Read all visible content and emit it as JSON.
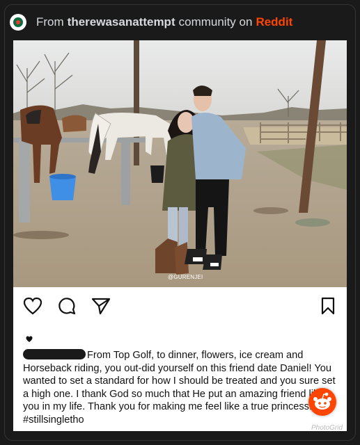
{
  "header": {
    "prefix": "From",
    "community": "therewasanattempt",
    "middle": "community on",
    "brand": "Reddit"
  },
  "post": {
    "photo_credit": "@GURENJEI",
    "caption": "From Top Golf, to dinner, flowers, ice cream and Horseback riding, you out-did yourself on this friend date Daniel! You wanted to set a standard for how I should be treated and you sure set a high one. I thank God so much that He put an amazing friend like you in my life. Thank you for making me feel like a true princess! #stillsingletho"
  },
  "watermark": "PhotoGrid",
  "colors": {
    "background": "#1a1a1b",
    "reddit_orange": "#ff4500",
    "community_icon": "#0e6b3e"
  },
  "icons": [
    "community-icon",
    "heart-icon",
    "comment-icon",
    "send-icon",
    "bookmark-icon",
    "reddit-snoo-icon"
  ]
}
